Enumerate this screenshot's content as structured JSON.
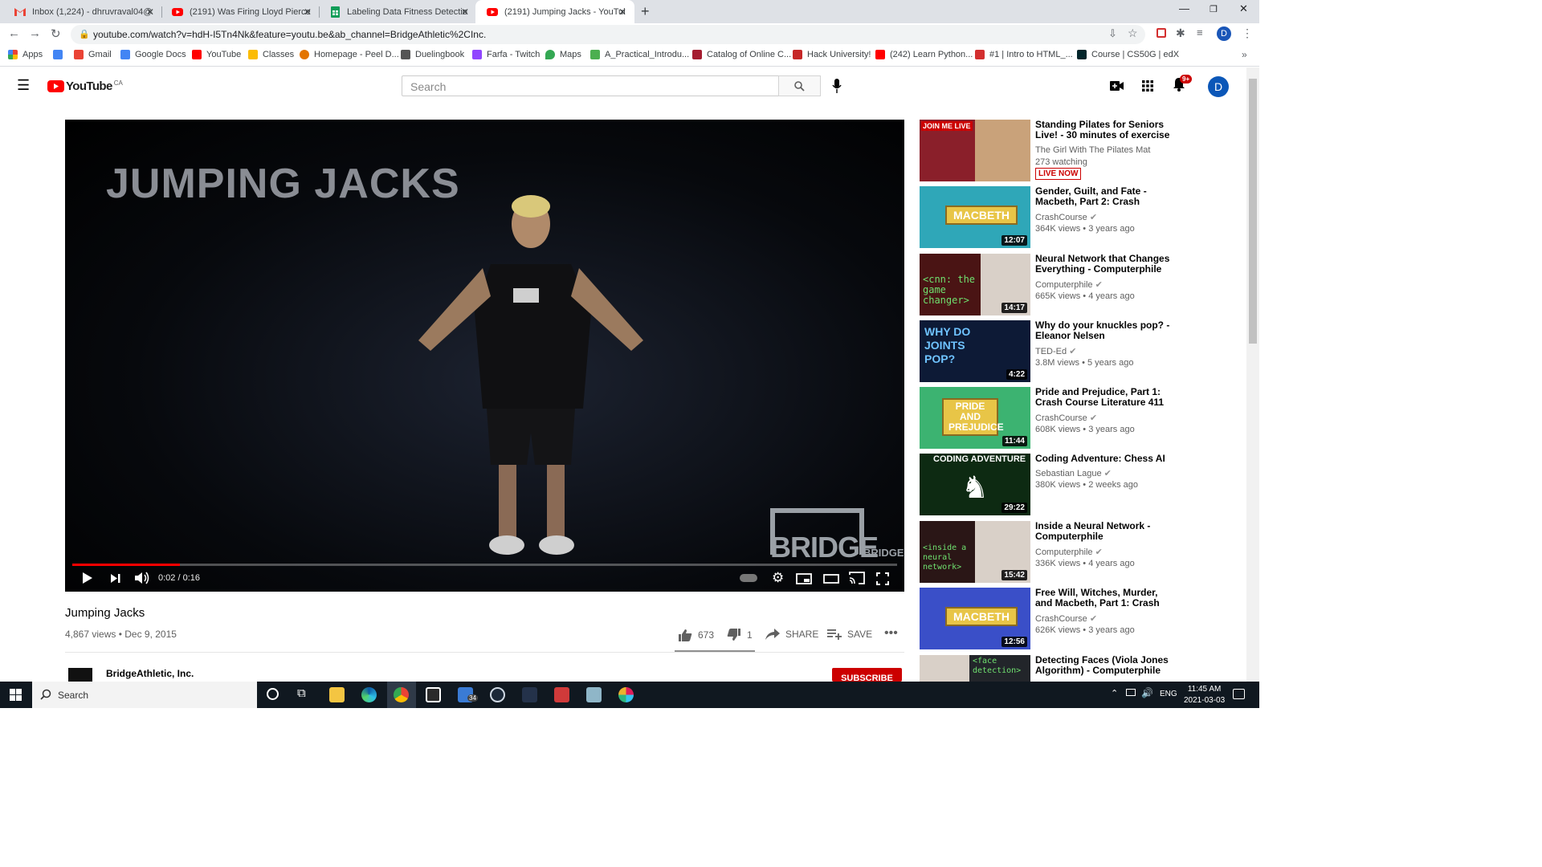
{
  "browser": {
    "tabs": [
      {
        "title": "Inbox (1,224) - dhruvraval04@gm",
        "icon": "gmail-icon"
      },
      {
        "title": "(2191) Was Firing Lloyd Pierce Th",
        "icon": "youtube-icon"
      },
      {
        "title": "Labeling Data Fitness Detection -",
        "icon": "sheets-icon"
      },
      {
        "title": "(2191) Jumping Jacks - YouTube",
        "icon": "youtube-icon"
      }
    ],
    "url": "youtube.com/watch?v=hdH-I5Tn4Nk&feature=youtu.be&ab_channel=BridgeAthletic%2CInc.",
    "bookmarks": [
      {
        "label": "Apps",
        "color": "#4285f4"
      },
      {
        "label": "",
        "color": "#4285f4"
      },
      {
        "label": "Gmail",
        "color": "#ea4335"
      },
      {
        "label": "Google Docs",
        "color": "#4285f4"
      },
      {
        "label": "YouTube",
        "color": "#ff0000"
      },
      {
        "label": "Classes",
        "color": "#fbbc04"
      },
      {
        "label": "Homepage - Peel D...",
        "color": "#e37400"
      },
      {
        "label": "Duelingbook",
        "color": "#555555"
      },
      {
        "label": "Farfa - Twitch",
        "color": "#9146ff"
      },
      {
        "label": "Maps",
        "color": "#34a853"
      },
      {
        "label": "A_Practical_Introdu...",
        "color": "#4caf50"
      },
      {
        "label": "Catalog of Online C...",
        "color": "#a51c30"
      },
      {
        "label": "Hack University!",
        "color": "#c62828"
      },
      {
        "label": "(242) Learn Python...",
        "color": "#ff0000"
      },
      {
        "label": "#1 | Intro to HTML_...",
        "color": "#d32f2f"
      },
      {
        "label": "Course | CS50G | edX",
        "color": "#02262b"
      }
    ]
  },
  "youtube": {
    "logo_text": "YouTube",
    "country": "CA",
    "search_placeholder": "Search",
    "notification_count": "9+",
    "avatar_letter": "D"
  },
  "video": {
    "overlay_title": "JUMPING JACKS",
    "watermark": "BRIDGE",
    "time": "0:02 / 0:16",
    "progress": 0.13,
    "title": "Jumping Jacks",
    "meta": "4,867 views • Dec 9, 2015",
    "likes": "673",
    "dislikes": "1",
    "share_label": "SHARE",
    "save_label": "SAVE",
    "channel": "BridgeAthletic, Inc.",
    "subscribe_label": "SUBSCRIBE"
  },
  "recommendations": [
    {
      "title": "Standing Pilates for Seniors Live! - 30 minutes of exercise t...",
      "channel": "The Girl With The Pilates Mat",
      "views": "273 watching",
      "badge": "LIVE NOW",
      "duration": "",
      "thumb_color": "#c47a3a",
      "verified": false
    },
    {
      "title": "Gender, Guilt, and Fate - Macbeth, Part 2: Crash Course...",
      "channel": "CrashCourse",
      "views": "364K views • 3 years ago",
      "duration": "12:07",
      "thumb_color": "#2fa7b8",
      "thumb_text": "MACBETH",
      "verified": true
    },
    {
      "title": "Neural Network that Changes Everything - Computerphile",
      "channel": "Computerphile",
      "views": "665K views • 4 years ago",
      "duration": "14:17",
      "thumb_color": "#3a1414",
      "thumb_text": "<cnn: the game changer>",
      "verified": true
    },
    {
      "title": "Why do your knuckles pop? - Eleanor Nelsen",
      "channel": "TED-Ed",
      "views": "3.8M views • 5 years ago",
      "duration": "4:22",
      "thumb_color": "#0d1a36",
      "thumb_text": "WHY DO JOINTS POP?",
      "verified": true
    },
    {
      "title": "Pride and Prejudice, Part 1: Crash Course Literature 411",
      "channel": "CrashCourse",
      "views": "608K views • 3 years ago",
      "duration": "11:44",
      "thumb_color": "#3cb371",
      "thumb_text": "PRIDE AND PREJUDICE",
      "verified": true
    },
    {
      "title": "Coding Adventure: Chess AI",
      "channel": "Sebastian Lague",
      "views": "380K views • 2 weeks ago",
      "duration": "29:22",
      "thumb_color": "#0d2a12",
      "thumb_text": "CODING ADVENTURE",
      "verified": true
    },
    {
      "title": "Inside a Neural Network - Computerphile",
      "channel": "Computerphile",
      "views": "336K views • 4 years ago",
      "duration": "15:42",
      "thumb_color": "#2a1616",
      "thumb_text": "<inside a neural network>",
      "verified": true
    },
    {
      "title": "Free Will, Witches, Murder, and Macbeth, Part 1: Crash Course...",
      "channel": "CrashCourse",
      "views": "626K views • 3 years ago",
      "duration": "12:56",
      "thumb_color": "#3a4fc8",
      "thumb_text": "MACBETH",
      "verified": true
    },
    {
      "title": "Detecting Faces (Viola Jones Algorithm) - Computerphile",
      "channel": "",
      "views": "",
      "duration": "",
      "thumb_color": "#22252a",
      "thumb_text": "<face detection>",
      "verified": false
    }
  ],
  "taskbar": {
    "search_label": "Search",
    "language": "ENG",
    "time": "11:45 AM",
    "date": "2021-03-03",
    "mail_badge": "34"
  }
}
